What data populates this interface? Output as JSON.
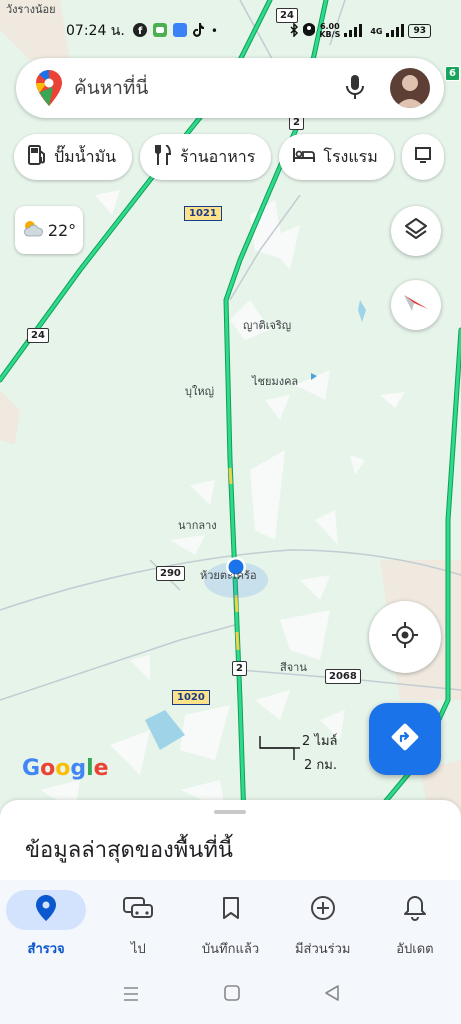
{
  "status_bar": {
    "time": "07:24 น.",
    "speed_top": "6.00",
    "speed_unit": "KB/S",
    "network": "4G",
    "battery": "93"
  },
  "search": {
    "placeholder": "ค้นหาที่นี่"
  },
  "chips": [
    {
      "label": "ปั๊มน้ำมัน",
      "icon": "gas-station-icon"
    },
    {
      "label": "ร้านอาหาร",
      "icon": "restaurant-icon"
    },
    {
      "label": "โรงแรม",
      "icon": "hotel-icon"
    }
  ],
  "weather": {
    "temp": "22°",
    "icon": "partly-cloudy-icon"
  },
  "map": {
    "places": {
      "yat_charoen": "ญาติเจริญ",
      "bu_yai": "บุใหญ่",
      "chai_mongkhon": "ไชยมงคล",
      "nak_klang": "นากลาง",
      "huai_current": "ห้วยตะเคร้อ",
      "si_chan": "สีจาน",
      "wang_rang_noi": "วังรางน้อย"
    },
    "routes": {
      "r24_top": "24",
      "r2_top": "2",
      "r1021": "1021",
      "r24_left": "24",
      "r290": "290",
      "r2_mid": "2",
      "r2068": "2068",
      "r1020": "1020",
      "r6_right": "6"
    },
    "scale_top": "2 ไมล์",
    "scale_bottom": "2 กม.",
    "brand": "Google"
  },
  "sheet": {
    "title": "ข้อมูลล่าสุดของพื้นที่นี้"
  },
  "nav": [
    {
      "label": "สำรวจ",
      "icon": "explore-pin-icon",
      "active": true
    },
    {
      "label": "ไป",
      "icon": "car-icon",
      "active": false
    },
    {
      "label": "บันทึกแล้ว",
      "icon": "bookmark-icon",
      "active": false
    },
    {
      "label": "มีส่วนร่วม",
      "icon": "add-circle-icon",
      "active": false
    },
    {
      "label": "อัปเดต",
      "icon": "bell-icon",
      "active": false
    }
  ],
  "colors": {
    "accent": "#1a73e8",
    "map_bg": "#e6f4ea",
    "highway": "#1ec77a"
  }
}
